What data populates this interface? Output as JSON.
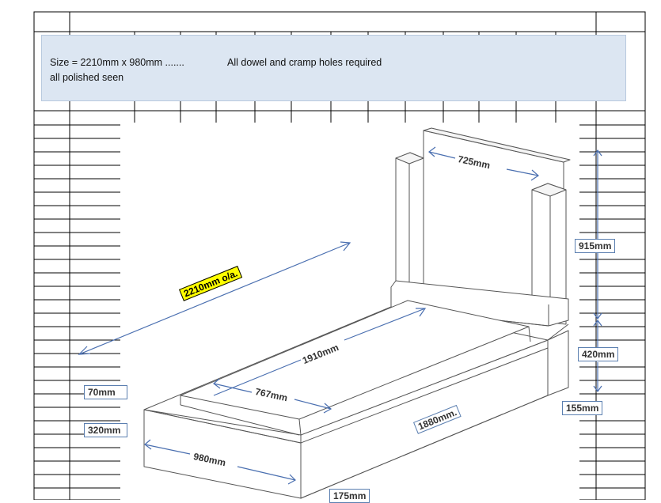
{
  "notes": {
    "size_text": "Size = 2210mm x 980mm .......",
    "holes_text": "All dowel and cramp holes required",
    "polish_text": "all polished seen"
  },
  "dimensions": {
    "overall_length": "2210mm o/a.",
    "upright_width": "725mm",
    "upright_height": "915mm",
    "base_height": "420mm",
    "inner_length": "1910mm",
    "inner_width": "767mm",
    "side_length": "1880mm.",
    "front_width": "980mm",
    "kerb_height_70": "70mm",
    "kerb_height_320": "320mm",
    "right_155": "155mm",
    "bottom_175": "175mm"
  },
  "colors": {
    "highlight": "#ffff00",
    "note_bg": "#dce6f2",
    "arrow": "#4a6fb0",
    "label_border": "#5b7fb0"
  }
}
